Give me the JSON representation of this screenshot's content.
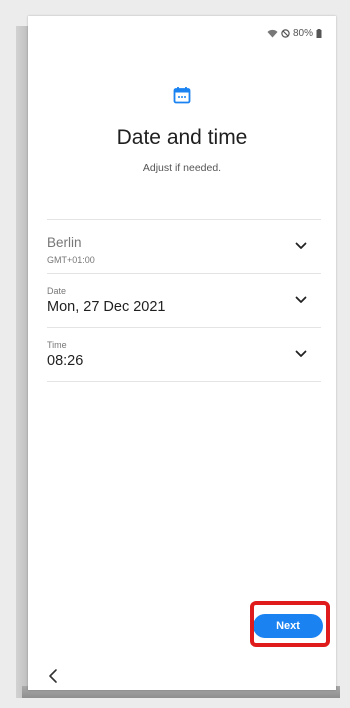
{
  "status_bar": {
    "icons": [
      "wifi-icon",
      "do-not-disturb-icon",
      "battery-icon"
    ],
    "battery_text": "80%"
  },
  "header": {
    "icon": "calendar-icon",
    "title": "Date and time",
    "subtitle": "Adjust if needed."
  },
  "settings": {
    "timezone": {
      "value": "Berlin",
      "offset": "GMT+01:00"
    },
    "date": {
      "label": "Date",
      "value": "Mon, 27 Dec 2021"
    },
    "time": {
      "label": "Time",
      "value": "08:26"
    }
  },
  "footer": {
    "next_label": "Next",
    "back_icon": "chevron-left-icon"
  },
  "colors": {
    "accent": "#1a83f1",
    "highlight": "#e01b1b"
  }
}
